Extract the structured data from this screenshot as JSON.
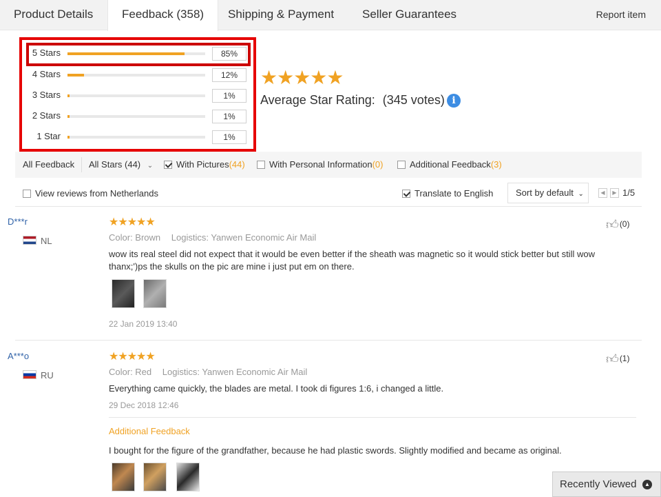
{
  "tabs": [
    {
      "label": "Product Details"
    },
    {
      "label": "Feedback (358)"
    },
    {
      "label": "Shipping & Payment"
    },
    {
      "label": "Seller Guarantees"
    }
  ],
  "report_label": "Report item",
  "rating": {
    "rows": [
      {
        "label": "5 Stars",
        "pct": "85%",
        "value": 0.85
      },
      {
        "label": "4 Stars",
        "pct": "12%",
        "value": 0.12
      },
      {
        "label": "3 Stars",
        "pct": "1%",
        "value": 0.01
      },
      {
        "label": "2 Stars",
        "pct": "1%",
        "value": 0.01
      },
      {
        "label": "1 Star",
        "pct": "1%",
        "value": 0.01
      }
    ],
    "stars": "★★★★★",
    "average_label": "Average Star Rating:",
    "votes": "(345 votes)",
    "info": "i"
  },
  "filters": {
    "all_feedback": "All Feedback",
    "all_stars": "All Stars (44)",
    "with_pictures": "With Pictures",
    "with_pictures_count": "(44)",
    "with_personal": "With Personal Information",
    "with_personal_count": "(0)",
    "additional": "Additional Feedback",
    "additional_count": "(3)"
  },
  "bar2": {
    "view_from": "View reviews from Netherlands",
    "translate": "Translate to English",
    "sort": "Sort by default",
    "page": "1/5"
  },
  "reviews": [
    {
      "user": "D***r",
      "country": "NL",
      "stars": "★★★★★",
      "color": "Color: Brown",
      "logistics": "Logistics: Yanwen Economic Air Mail",
      "text": "wow its real steel did not expect that it would be even better if the sheath was magnetic so it would stick better but still wow thanx;')ps the skulls on the pic are mine i just put em on there.",
      "date": "22 Jan 2019 13:40",
      "likes": "(0)"
    },
    {
      "user": "A***o",
      "country": "RU",
      "stars": "★★★★★",
      "color": "Color: Red",
      "logistics": "Logistics: Yanwen Economic Air Mail",
      "text": "Everything came quickly, the blades are metal. I took di figures 1:6, i changed a little.",
      "date": "29 Dec 2018 12:46",
      "likes": "(1)",
      "additional_label": "Additional Feedback",
      "additional_text": "I bought for the figure of the grandfather, because he had plastic swords. Slightly modified and became as original."
    }
  ],
  "recent_viewed": "Recently Viewed",
  "colors": {
    "accent": "#f0a223",
    "highlight": "#e60000",
    "link": "#3062a8"
  }
}
